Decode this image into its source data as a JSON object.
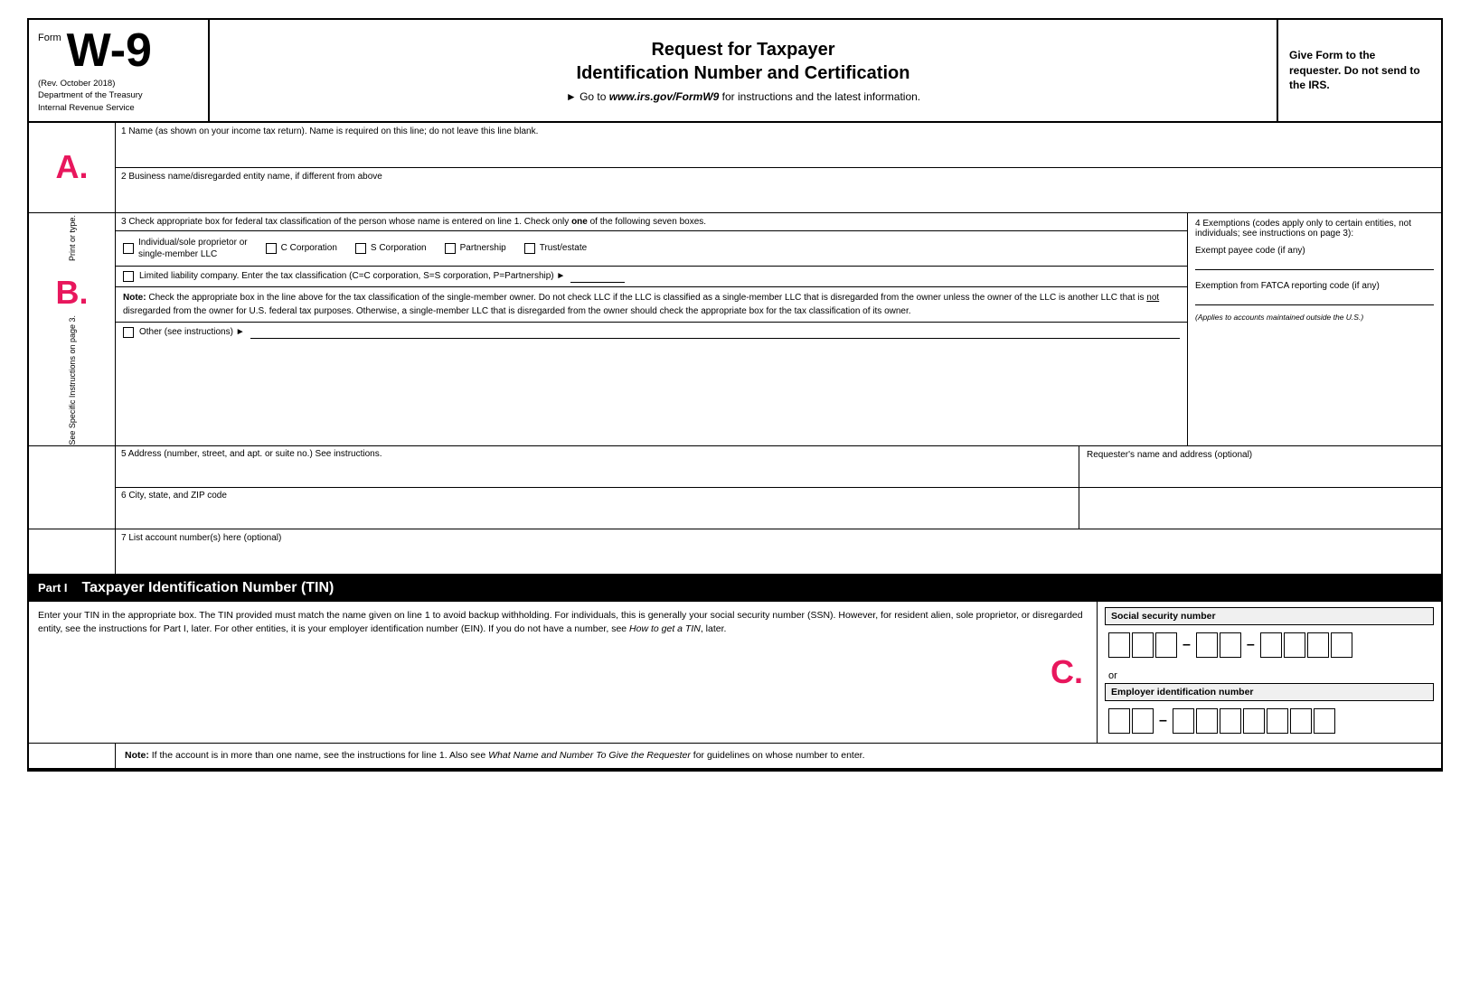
{
  "header": {
    "form_word": "Form",
    "form_number": "W-9",
    "rev": "(Rev. October 2018)",
    "dept": "Department of the Treasury",
    "irs": "Internal Revenue Service",
    "main_title_line1": "Request for Taxpayer",
    "main_title_line2": "Identification Number and Certification",
    "go_to_prefix": "► Go to ",
    "website": "www.irs.gov/FormW9",
    "go_to_suffix": " for instructions and the latest information.",
    "right_text": "Give Form to the requester. Do not send to the IRS."
  },
  "fields": {
    "field1_label": "1  Name (as shown on your income tax return). Name is required on this line; do not leave this line blank.",
    "field2_label": "2  Business name/disregarded entity name, if different from above",
    "field3_label": "3  Check appropriate box for federal tax classification of the person whose name is entered on line 1. Check only",
    "field3_bold": "one",
    "field3_label_after": "of the following seven boxes.",
    "field4_label": "4  Exemptions (codes apply only to certain entities, not individuals; see instructions on page 3):",
    "exempt_payee_label": "Exempt payee code (if any)",
    "fatca_label": "Exemption from FATCA reporting code (if any)",
    "applies_note": "(Applies to accounts maintained outside the U.S.)",
    "cb_individual": "Individual/sole proprietor or\nsingle-member LLC",
    "cb_c_corp": "C Corporation",
    "cb_s_corp": "S Corporation",
    "cb_partnership": "Partnership",
    "cb_trust": "Trust/estate",
    "llc_label": "Limited liability company. Enter the tax classification (C=C corporation, S=S corporation, P=Partnership) ►",
    "note_label": "Note:",
    "note_text": " Check the appropriate box in the line above for the tax classification of the single-member owner.  Do not check LLC if the LLC is classified as a single-member LLC that is disregarded from the owner unless the owner of the LLC is another LLC that is ",
    "note_not": "not",
    "note_text2": " disregarded from the owner for U.S. federal tax purposes. Otherwise, a single-member LLC that is disregarded from the owner should check the appropriate box for the tax classification of its owner.",
    "other_label": "Other (see instructions) ►",
    "field5_label": "5  Address (number, street, and apt. or suite no.) See instructions.",
    "requesters_label": "Requester's name and address (optional)",
    "field6_label": "6  City, state, and ZIP code",
    "field7_label": "7  List account number(s) here (optional)",
    "part1_label": "Part I",
    "part1_title": "Taxpayer Identification Number (TIN)",
    "part1_text": "Enter your TIN in the appropriate box. The TIN provided must match the name given on line 1 to avoid backup withholding. For individuals, this is generally your social security number (SSN). However, for resident alien, sole proprietor, or disregarded entity, see the instructions for Part I, later. For other entities, it is your employer identification number (EIN). If you do not have a number, see ",
    "part1_italic": "How to get a TIN",
    "part1_text2": ", later.",
    "note2_label": "Note:",
    "note2_text": " If the account is in more than one name, see the instructions for line 1. Also see ",
    "note2_italic": "What Name and Number To Give the Requester",
    "note2_text2": " for guidelines on whose number to enter.",
    "ssn_label": "Social security number",
    "or_text": "or",
    "ein_label": "Employer identification number",
    "side_print": "Print or type.",
    "side_see": "See Specific Instructions on page 3."
  },
  "labels": {
    "a": "A.",
    "b": "B.",
    "c": "C."
  }
}
